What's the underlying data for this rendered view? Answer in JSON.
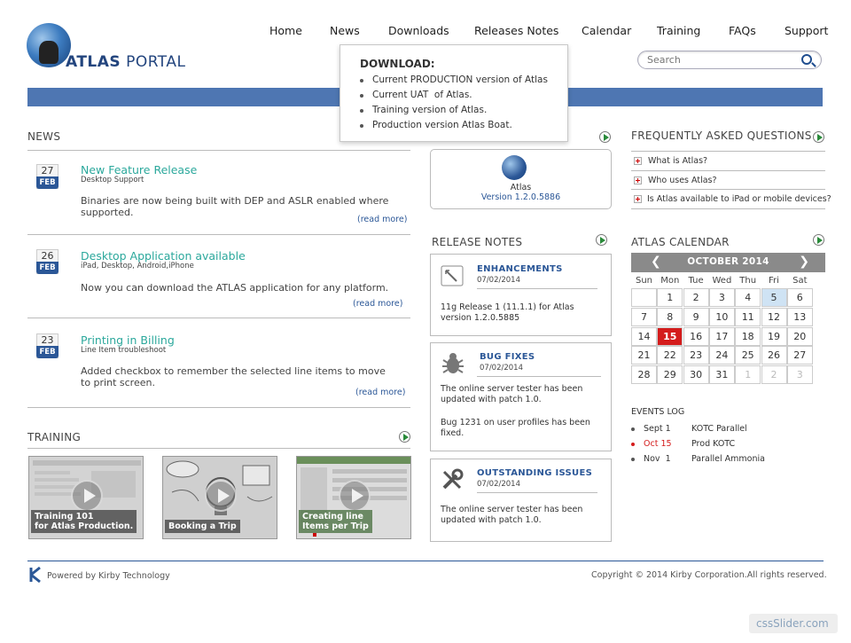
{
  "brand": {
    "name_bold": "ATLAS",
    "name_rest": " PORTAL"
  },
  "nav": [
    "Home",
    "News",
    "Downloads",
    "Releases Notes",
    "Calendar",
    "Training",
    "FAQs",
    "Support"
  ],
  "search": {
    "placeholder": "Search"
  },
  "dropdown": {
    "title": "DOWNLOAD:",
    "items": [
      "Current PRODUCTION version of Atlas",
      "Current UAT  of Atlas.",
      "Training version of Atlas.",
      "Production version Atlas Boat."
    ]
  },
  "news": {
    "title": "NEWS",
    "items": [
      {
        "day": "27",
        "month": "FEB",
        "title": "New Feature Release",
        "sub": "Desktop Support",
        "body": "Binaries are now being built with DEP and ASLR enabled where supported.",
        "more": "(read more)"
      },
      {
        "day": "26",
        "month": "FEB",
        "title": "Desktop Application available",
        "sub": "iPad, Desktop, Android,iPhone",
        "body": "Now you can download the ATLAS application for any platform.",
        "more": "(read more)"
      },
      {
        "day": "23",
        "month": "FEB",
        "title": "Printing in Billing",
        "sub": "Line Item troubleshoot",
        "body": "Added checkbox to remember the selected line items to move to print screen.",
        "more": "(read more)"
      }
    ]
  },
  "app_card": {
    "name": "Atlas",
    "version": "Version 1.2.0.5886"
  },
  "release_notes": {
    "title": "RELEASE NOTES",
    "items": [
      {
        "title": "ENHANCEMENTS",
        "date": "07/02/2014",
        "body": [
          "11g Release 1 (11.1.1) for Atlas version 1.2.0.5885"
        ],
        "icon": "document-icon"
      },
      {
        "title": "BUG FIXES",
        "date": "07/02/2014",
        "body": [
          "The online server tester has been updated with patch 1.0.",
          "Bug 1231 on user profiles has been fixed."
        ],
        "icon": "bug-icon"
      },
      {
        "title": "OUTSTANDING ISSUES",
        "date": "07/02/2014",
        "body": [
          "The online server tester has been updated with patch 1.0."
        ],
        "icon": "tools-icon"
      }
    ]
  },
  "faq": {
    "title": "FREQUENTLY ASKED QUESTIONS",
    "items": [
      "What is Atlas?",
      "Who uses Atlas?",
      "Is Atlas available to iPad or mobile devices?"
    ]
  },
  "calendar": {
    "title": "ATLAS CALENDAR",
    "month": "OCTOBER 2014",
    "prev": "❮",
    "next": "❯",
    "weekdays": [
      "Sun",
      "Mon",
      "Tue",
      "Wed",
      "Thu",
      "Fri",
      "Sat"
    ],
    "weeks": [
      [
        "",
        "1",
        "2",
        "3",
        "4",
        "5",
        "6"
      ],
      [
        "7",
        "8",
        "9",
        "10",
        "11",
        "12",
        "13"
      ],
      [
        "14",
        "15",
        "16",
        "17",
        "18",
        "19",
        "20"
      ],
      [
        "21",
        "22",
        "23",
        "24",
        "25",
        "26",
        "27"
      ],
      [
        "28",
        "29",
        "30",
        "31",
        "1",
        "2",
        "3"
      ]
    ],
    "today": "15",
    "highlight": "5",
    "events_title": "EVENTS LOG",
    "events": [
      {
        "date": "Sept 1",
        "name": "KOTC Parallel",
        "color": "#555555"
      },
      {
        "date": "Oct 15",
        "name": "Prod KOTC",
        "color": "#d41c1c"
      },
      {
        "date": "Nov  1",
        "name": "Parallel Ammonia",
        "color": "#555555"
      }
    ]
  },
  "training": {
    "title": "TRAINING",
    "videos": [
      {
        "caption": "Training 101\nfor Atlas Production."
      },
      {
        "caption": "Booking a Trip"
      },
      {
        "caption": "Creating line\nItems per Trip"
      }
    ]
  },
  "footer": {
    "powered": "Powered by Kirby Technology",
    "copyright": "Copyright © 2014 Kirby Corporation.All rights reserved."
  },
  "badge": "cssSlider.com",
  "colors": {
    "accent": "#2b5797",
    "teal": "#2ba89c",
    "bar": "#4e76b2",
    "today": "#d41c1c"
  }
}
